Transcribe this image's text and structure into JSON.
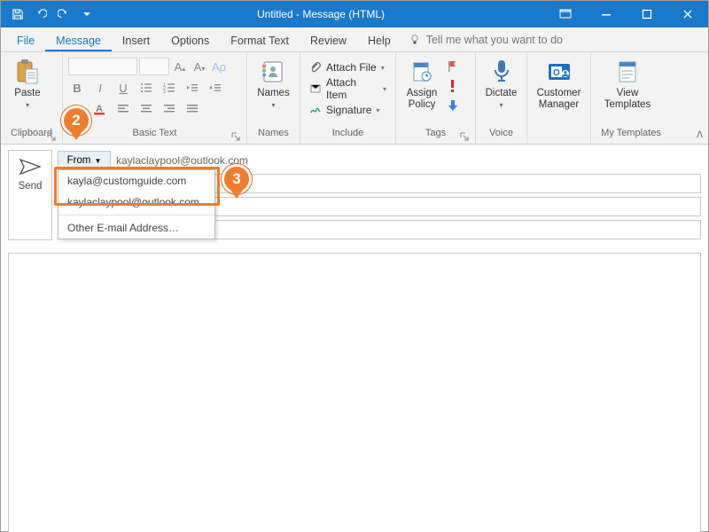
{
  "window": {
    "title": "Untitled  -  Message (HTML)"
  },
  "tabs": {
    "file": "File",
    "message": "Message",
    "insert": "Insert",
    "options": "Options",
    "format_text": "Format Text",
    "review": "Review",
    "help": "Help",
    "tell_me": "Tell me what you want to do"
  },
  "ribbon": {
    "clipboard": {
      "label": "Clipboard",
      "paste": "Paste"
    },
    "basic_text": {
      "label": "Basic Text"
    },
    "names": {
      "label": "Names",
      "names_btn": "Names"
    },
    "include": {
      "label": "Include",
      "attach_file": "Attach File",
      "attach_item": "Attach Item",
      "signature": "Signature"
    },
    "tags": {
      "label": "Tags",
      "assign_policy": "Assign\nPolicy"
    },
    "voice": {
      "label": "Voice",
      "dictate": "Dictate"
    },
    "customer_manager": "Customer\nManager",
    "my_templates": {
      "label": "My Templates",
      "view_templates": "View\nTemplates"
    }
  },
  "compose": {
    "send": "Send",
    "from_label": "From",
    "from_value": "kaylaclaypool@outlook.com",
    "menu": {
      "item1": "kayla@customguide.com",
      "item2": "kaylaclaypool@outlook.com",
      "other": "Other E-mail Address…"
    }
  },
  "markers": {
    "m2": "2",
    "m3": "3"
  }
}
